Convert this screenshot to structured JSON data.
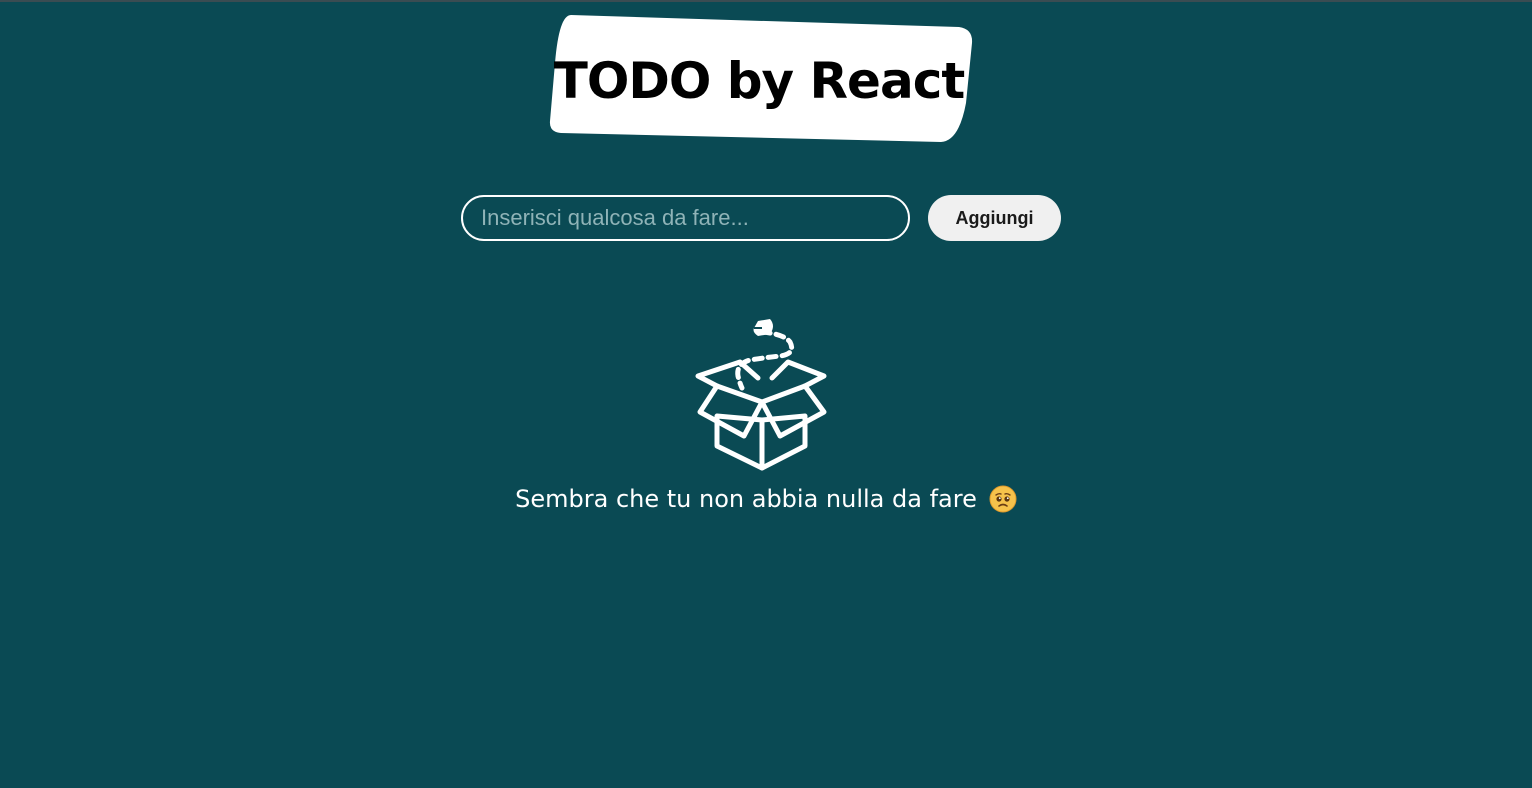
{
  "header": {
    "title": "TODO by React"
  },
  "form": {
    "input_placeholder": "Inserisci qualcosa da fare...",
    "input_value": "",
    "add_label": "Aggiungi"
  },
  "empty_state": {
    "icon": "open-box-icon",
    "message": "Sembra che tu non abbia nulla da fare",
    "emoji": "pleading-face-emoji"
  },
  "colors": {
    "background": "#0a4a54",
    "title_background": "#ffffff",
    "button_background": "#f0f0f0",
    "text": "#ffffff"
  }
}
